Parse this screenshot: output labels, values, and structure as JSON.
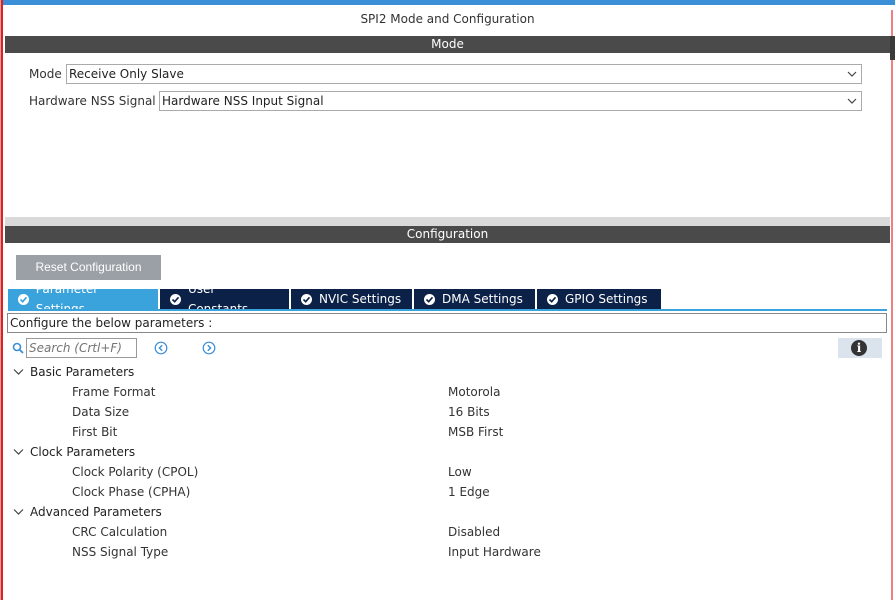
{
  "window": {
    "title": "SPI2 Mode and Configuration"
  },
  "mode_section": {
    "header": "Mode",
    "mode_label": "Mode",
    "mode_value": "Receive Only Slave",
    "nss_label": "Hardware NSS Signal",
    "nss_value": "Hardware NSS Input Signal"
  },
  "config_section": {
    "header": "Configuration",
    "reset_label": "Reset Configuration",
    "tabs": [
      {
        "label": "Parameter Settings",
        "active": true
      },
      {
        "label": "User Constants",
        "active": false
      },
      {
        "label": "NVIC Settings",
        "active": false
      },
      {
        "label": "DMA Settings",
        "active": false
      },
      {
        "label": "GPIO Settings",
        "active": false
      }
    ],
    "description": "Configure the below parameters :",
    "search_placeholder": "Search (Crtl+F)"
  },
  "groups": [
    {
      "name": "Basic Parameters",
      "params": [
        {
          "name": "Frame Format",
          "value": "Motorola"
        },
        {
          "name": "Data Size",
          "value": "16 Bits"
        },
        {
          "name": "First Bit",
          "value": "MSB First"
        }
      ]
    },
    {
      "name": "Clock Parameters",
      "params": [
        {
          "name": "Clock Polarity (CPOL)",
          "value": "Low"
        },
        {
          "name": "Clock Phase (CPHA)",
          "value": "1 Edge"
        }
      ]
    },
    {
      "name": "Advanced Parameters",
      "params": [
        {
          "name": "CRC Calculation",
          "value": "Disabled"
        },
        {
          "name": "NSS Signal Type",
          "value": "Input Hardware"
        }
      ]
    }
  ],
  "colors": {
    "band": "#4a4a4a",
    "tab_active": "#3ba3dc",
    "tab_inactive": "#0b2147",
    "reset_button": "#9aa0a6"
  }
}
